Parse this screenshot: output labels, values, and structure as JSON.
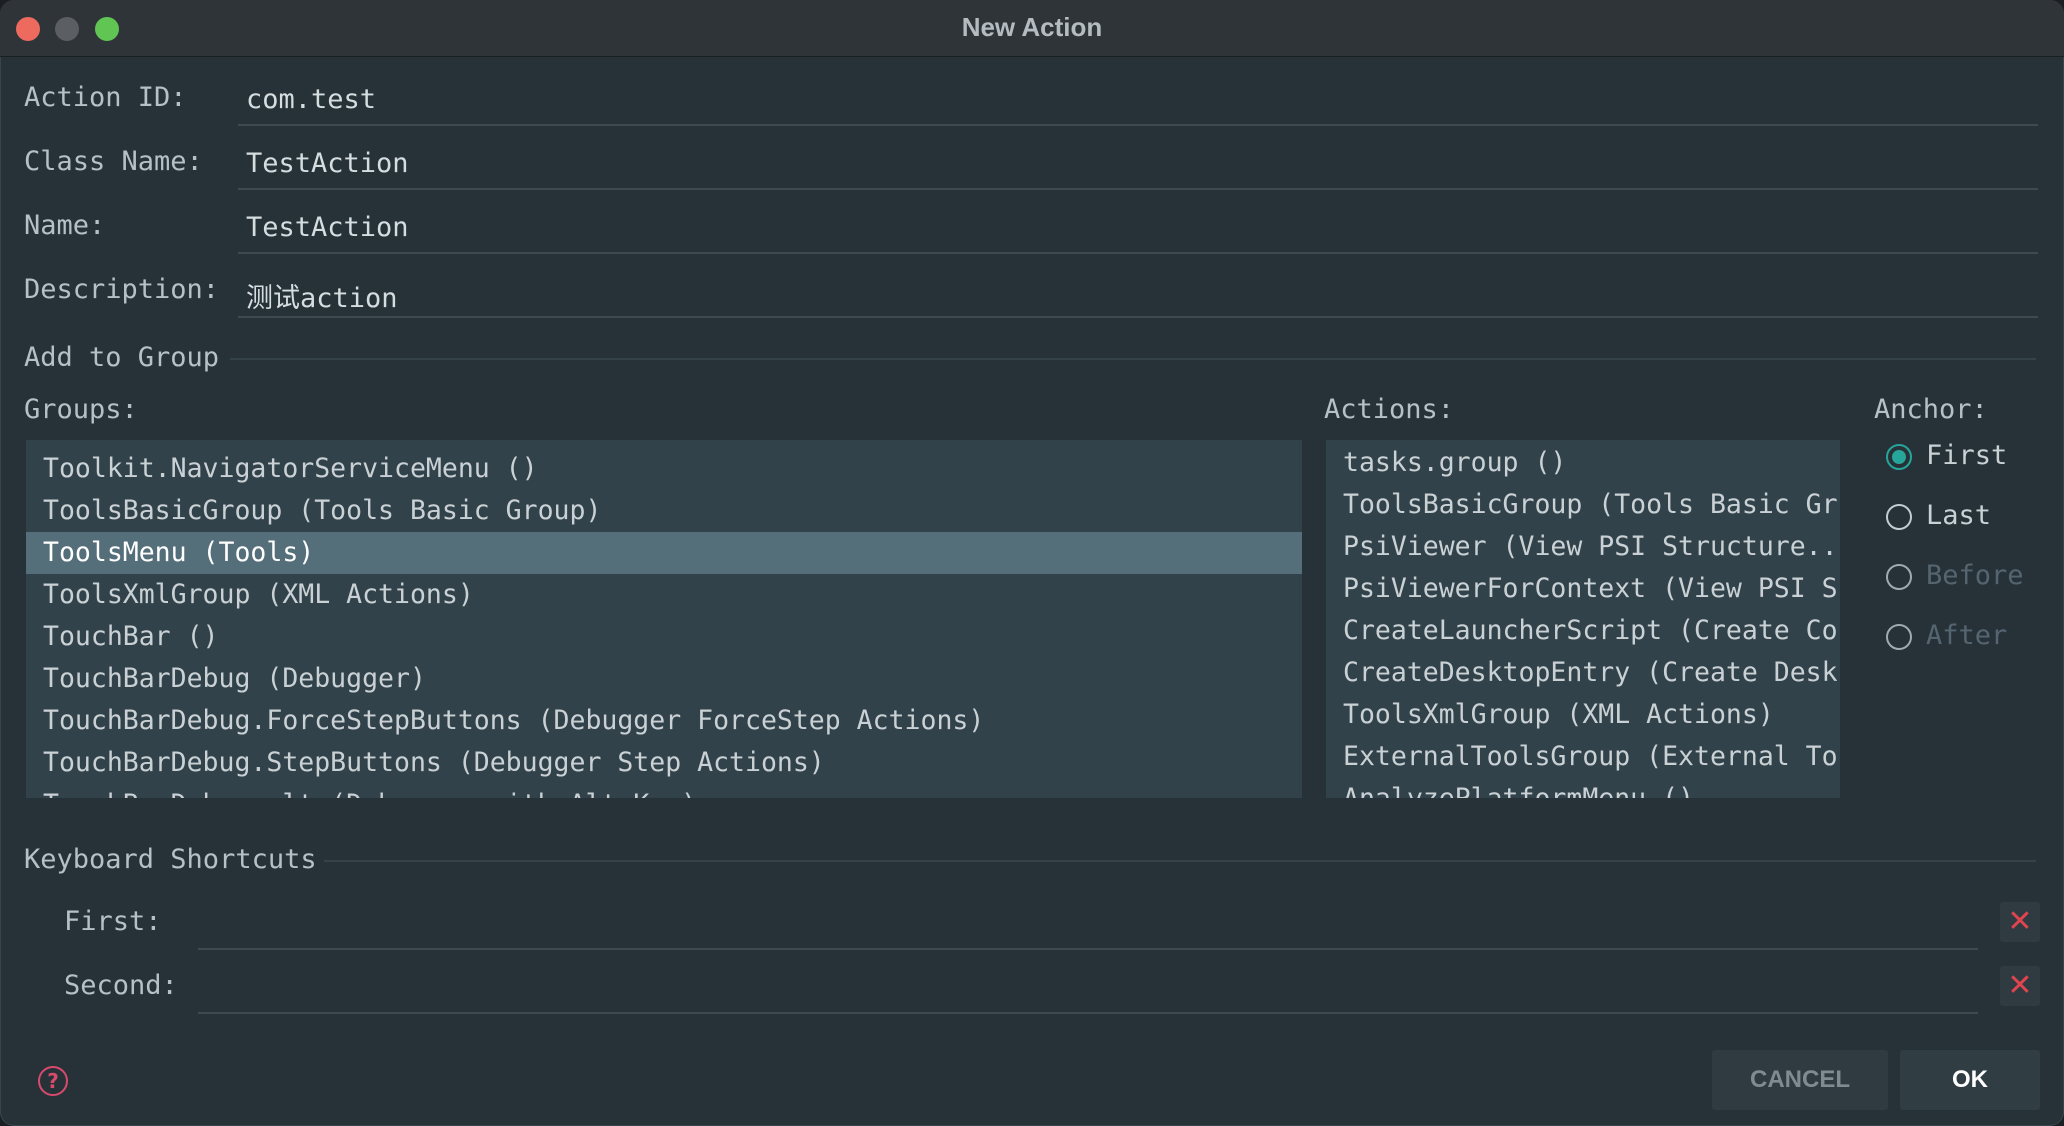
{
  "window": {
    "title": "New Action"
  },
  "form": {
    "action_id": {
      "label": "Action ID:",
      "value": "com.test"
    },
    "class_name": {
      "label": "Class Name:",
      "value": "TestAction"
    },
    "name": {
      "label": "Name:",
      "value": "TestAction"
    },
    "description": {
      "label": "Description:",
      "value": "测试action"
    }
  },
  "add_to_group": {
    "title": "Add to Group",
    "groups_label": "Groups:",
    "actions_label": "Actions:",
    "anchor_label": "Anchor:",
    "groups": [
      "Toolkit.NavigatorServiceMenu ()",
      "ToolsBasicGroup (Tools Basic Group)",
      "ToolsMenu (Tools)",
      "ToolsXmlGroup (XML Actions)",
      "TouchBar ()",
      "TouchBarDebug (Debugger)",
      "TouchBarDebug.ForceStepButtons (Debugger ForceStep Actions)",
      "TouchBarDebug.StepButtons (Debugger Step Actions)",
      "TouchBarDebug.alt (Debugger with Alt Key)"
    ],
    "selected_group": "ToolsMenu (Tools)",
    "actions": [
      "tasks.group ()",
      "ToolsBasicGroup (Tools Basic Gr",
      "PsiViewer (View PSI Structure..",
      "PsiViewerForContext (View PSI S",
      "CreateLauncherScript (Create Co",
      "CreateDesktopEntry (Create Desk",
      "ToolsXmlGroup (XML Actions)",
      "ExternalToolsGroup (External To",
      "AnalyzePlatformMenu ()"
    ],
    "anchors": [
      {
        "label": "First",
        "checked": true,
        "enabled": true
      },
      {
        "label": "Last",
        "checked": false,
        "enabled": true
      },
      {
        "label": "Before",
        "checked": false,
        "enabled": false
      },
      {
        "label": "After",
        "checked": false,
        "enabled": false
      }
    ]
  },
  "keyboard_shortcuts": {
    "title": "Keyboard Shortcuts",
    "first_label": "First:",
    "second_label": "Second:",
    "first_value": "",
    "second_value": "",
    "clear_symbol": "✕"
  },
  "buttons": {
    "cancel": "CANCEL",
    "ok": "OK",
    "help_symbol": "?"
  },
  "colors": {
    "accent": "#26a69a",
    "selection": "#546e7a",
    "clear": "#e0454f",
    "help": "#d84a6b"
  }
}
